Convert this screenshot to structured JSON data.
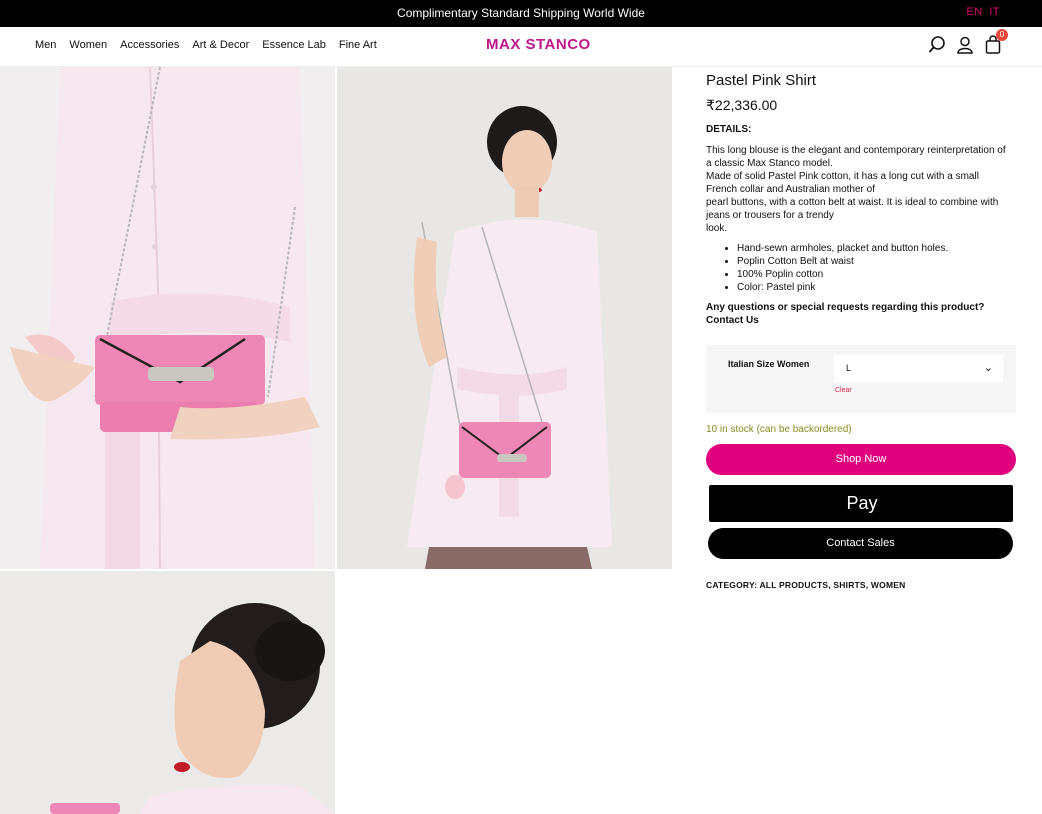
{
  "topbar": {
    "message": "Complimentary Standard Shipping World Wide",
    "lang_en": "EN",
    "lang_it": "IT"
  },
  "header": {
    "nav": [
      "Men",
      "Women",
      "Accessories",
      "Art & Decor",
      "Essence Lab",
      "Fine Art"
    ],
    "logo": "MAX STANCO",
    "cart_count": "0"
  },
  "product": {
    "title": "Pastel Pink Shirt",
    "price": "₹22,336.00",
    "details_label": "DETAILS:",
    "description": [
      "This long blouse is the elegant and contemporary reinterpretation of a classic Max Stanco model.",
      "Made of solid Pastel Pink cotton, it has a long cut with a small French collar and Australian mother of",
      "pearl buttons, with a cotton belt at waist. It is ideal to combine with jeans or trousers for a trendy",
      "look."
    ],
    "bullets": [
      "Hand-sewn armholes, placket and button holes.",
      "Poplin Cotton Belt at waist",
      "100% Poplin cotton",
      "Color: Pastel pink"
    ],
    "questions": "Any questions or special requests regarding this product? Contact Us",
    "size_label": "Italian Size Women",
    "size_value": "L",
    "clear_label": "Clear",
    "stock": "10 in stock (can be backordered)",
    "shop_now": "Shop Now",
    "apple_pay": "Pay",
    "contact_sales": "Contact Sales",
    "category": "CATEGORY: ALL PRODUCTS, SHIRTS, WOMEN"
  },
  "colors": {
    "accent": "#e0007d",
    "logo": "#c0148a",
    "bag_pink": "#ee86b6",
    "shirt_pink": "#f8e6ee"
  }
}
